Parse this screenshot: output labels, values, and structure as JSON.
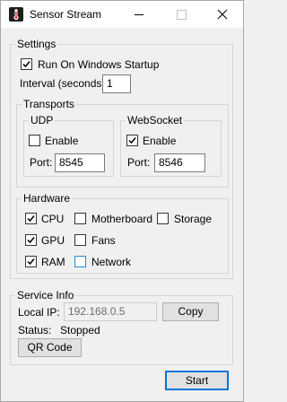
{
  "window": {
    "title": "Sensor Stream",
    "icon": "thermometer-icon"
  },
  "settings": {
    "group_title": "Settings",
    "startup": {
      "label": "Run On Windows Startup",
      "checked": true
    },
    "interval_label": "Interval (seconds):",
    "interval_value": "1",
    "transports": {
      "group_title": "Transports",
      "udp": {
        "title": "UDP",
        "enable_label": "Enable",
        "enabled": false,
        "port_label": "Port:",
        "port_value": "8545"
      },
      "websocket": {
        "title": "WebSocket",
        "enable_label": "Enable",
        "enabled": true,
        "port_label": "Port:",
        "port_value": "8546"
      }
    },
    "hardware": {
      "group_title": "Hardware",
      "items": [
        {
          "label": "CPU",
          "checked": true
        },
        {
          "label": "Motherboard",
          "checked": false
        },
        {
          "label": "Storage",
          "checked": false
        },
        {
          "label": "GPU",
          "checked": true
        },
        {
          "label": "Fans",
          "checked": false
        },
        {
          "label": "RAM",
          "checked": true
        },
        {
          "label": "Network",
          "checked": false
        }
      ]
    }
  },
  "service_info": {
    "group_title": "Service Info",
    "local_ip_label": "Local IP:",
    "local_ip_value": "192.168.0.5",
    "copy_label": "Copy",
    "status_label": "Status:",
    "status_value": "Stopped",
    "qr_label": "QR Code"
  },
  "footer": {
    "start_label": "Start"
  },
  "colors": {
    "background": "#f0f0f0",
    "accent": "#0078d7",
    "checkbox_focus": "#1f8ad2"
  }
}
